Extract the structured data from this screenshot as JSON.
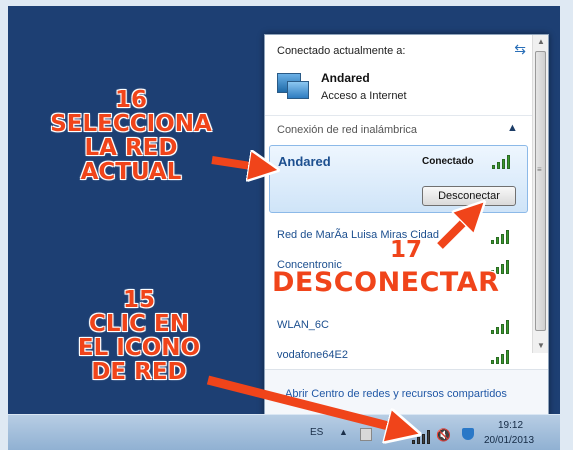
{
  "flyout": {
    "connected_header": "Conectado actualmente a:",
    "current_network": {
      "name": "Andared",
      "subtitle": "Acceso a Internet"
    },
    "section_label": "Conexión de red inalámbrica",
    "selected": {
      "name": "Andared",
      "status": "Conectado",
      "button_label": "Desconectar"
    },
    "networks": [
      {
        "name": "Red de MarÃ­a Luisa Miras Cidad"
      },
      {
        "name": "Concentronic"
      },
      {
        "name": ""
      },
      {
        "name": "WLAN_6C"
      },
      {
        "name": "vodafone64E2"
      }
    ],
    "footer_link": "Abrir Centro de redes y recursos compartidos"
  },
  "taskbar": {
    "language": "ES",
    "time": "19:12",
    "date": "20/01/2013"
  },
  "annotations": {
    "step16": [
      "16",
      "SELECCIONA",
      "LA RED",
      "ACTUAL"
    ],
    "step15": [
      "15",
      "CLIC EN",
      "EL ICONO",
      "DE RED"
    ],
    "step17_number": "17",
    "step17_text": "DESCONECTAR"
  },
  "colors": {
    "desktop": "#1d3f73",
    "annotation": "#f0441a",
    "link": "#1c4f8f",
    "signal": "#3a9a2e"
  },
  "icons": [
    "refresh-icon",
    "network-computer-icon",
    "chevron-up-icon",
    "wifi-signal-icon",
    "volume-muted-icon",
    "security-shield-icon"
  ]
}
